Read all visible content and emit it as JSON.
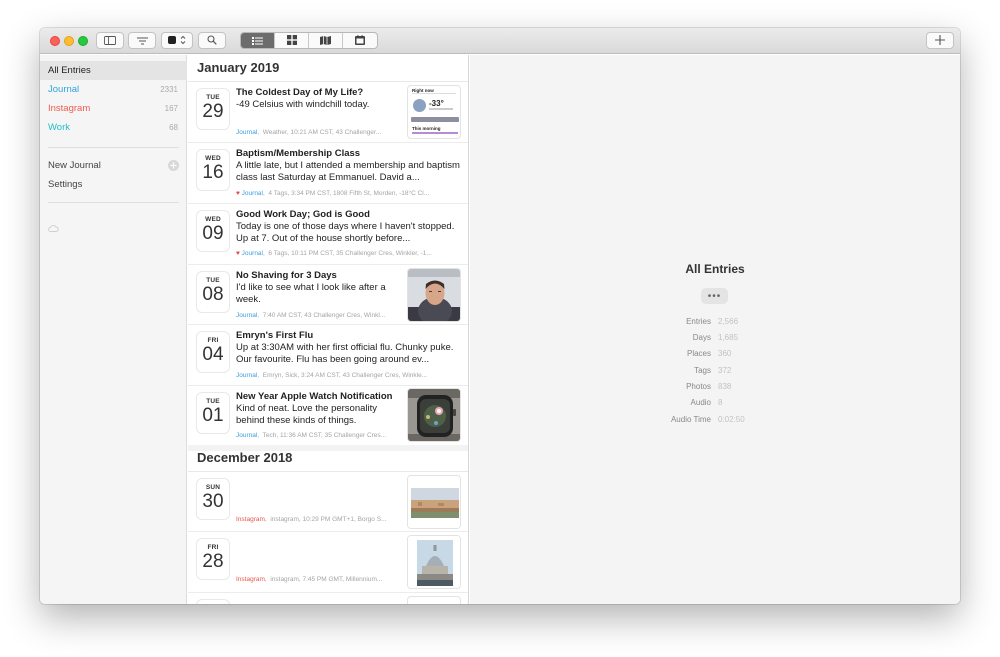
{
  "toolbar": {
    "sidebar_icon": "sidebar-icon",
    "filter_icon": "filter-icon",
    "search_icon": "search-icon",
    "view_tabs": [
      "list-view-icon",
      "grid-view-icon",
      "map-view-icon",
      "calendar-view-icon"
    ],
    "new_entry_icon": "plus-icon",
    "add_label": "+"
  },
  "sidebar": {
    "all_entries": "All Entries",
    "journals": [
      {
        "label": "Journal",
        "count": "2331",
        "color": "#2fa4df"
      },
      {
        "label": "Instagram",
        "count": "167",
        "color": "#ee5a4f"
      },
      {
        "label": "Work",
        "count": "68",
        "color": "#21bfc4"
      }
    ],
    "new_journal": "New Journal",
    "settings": "Settings",
    "cloud_icon": "cloud-icon"
  },
  "list": {
    "months": [
      "January 2019",
      "December 2018"
    ],
    "entries": [
      {
        "dow": "TUE",
        "day": "29",
        "title": "The Coldest Day of My Life?",
        "body": "-49 Celsius with windchill today.",
        "journal": "Journal",
        "meta": "Weather,  10:21 AM CST,  43 Challenger...",
        "favorite": false,
        "thumb": "weather-screenshot"
      },
      {
        "dow": "WED",
        "day": "16",
        "title": "Baptism/Membership Class",
        "body": "A little late, but I attended a membership and baptism class last Saturday at Emmanuel. David a...",
        "journal": "Journal",
        "meta": "4 Tags,  3:34 PM CST,  1808 Fifth St,  Morden,  -18°C Cl...",
        "favorite": true,
        "thumb": null
      },
      {
        "dow": "WED",
        "day": "09",
        "title": "Good Work Day; God is Good",
        "body": "Today is one of those days where I haven't stopped. Up at 7. Out of the house shortly before...",
        "journal": "Journal",
        "meta": "6 Tags,  10:11 PM CST,  35 Challenger Cres,  Winkler,  -1...",
        "favorite": true,
        "thumb": null
      },
      {
        "dow": "TUE",
        "day": "08",
        "title": "No Shaving for 3 Days",
        "body": "I'd like to see what I look like after a week.",
        "journal": "Journal",
        "meta": "7:40 AM CST,  43 Challenger Cres,  Winkl...",
        "favorite": false,
        "thumb": "selfie-photo"
      },
      {
        "dow": "FRI",
        "day": "04",
        "title": "Emryn's First Flu",
        "body": "Up at 3:30AM with her first official flu. Chunky puke. Our favourite. Flu has been going around ev...",
        "journal": "Journal",
        "meta": "Emryn,  Sick,  3:24 AM CST,  43 Challenger Cres,  Winkle...",
        "favorite": false,
        "thumb": null
      },
      {
        "dow": "TUE",
        "day": "01",
        "title": "New Year Apple Watch Notification",
        "body": "Kind of neat. Love the personality behind these kinds of things.",
        "journal": "Journal",
        "meta": "Tech,  11:36 AM CST,  35 Challenger Cres...",
        "favorite": false,
        "thumb": "apple-watch-photo"
      },
      {
        "dow": "SUN",
        "day": "30",
        "title": "",
        "body": "",
        "journal": "Instagram",
        "meta": "instagram,  10:29 PM GMT+1,  Borgo S...",
        "favorite": false,
        "thumb": "florence-photo"
      },
      {
        "dow": "FRI",
        "day": "28",
        "title": "",
        "body": "",
        "journal": "Instagram",
        "meta": "instagram,  7:45 PM GMT,  Millennium...",
        "favorite": false,
        "thumb": "st-pauls-photo"
      }
    ]
  },
  "weather_thumb": {
    "heading": "Right now",
    "temp": "-33°",
    "footer": "This morning"
  },
  "detail": {
    "title": "All Entries",
    "more_label": "•••",
    "stats": [
      {
        "key": "Entries",
        "value": "2,566"
      },
      {
        "key": "Days",
        "value": "1,685"
      },
      {
        "key": "Places",
        "value": "360"
      },
      {
        "key": "Tags",
        "value": "372"
      },
      {
        "key": "Photos",
        "value": "838"
      },
      {
        "key": "Audio",
        "value": "8"
      },
      {
        "key": "Audio Time",
        "value": "0:02:50"
      }
    ]
  }
}
